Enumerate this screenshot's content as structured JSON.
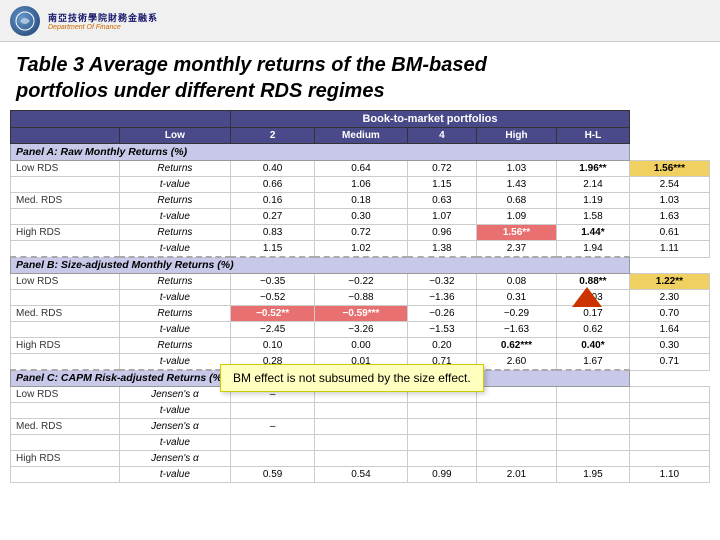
{
  "header": {
    "logo_cn": "南亞技術學院財務金融系",
    "logo_en": "Department Of Finance"
  },
  "title": {
    "line1": "Table 3  Average monthly returns of the BM-based",
    "line2": "portfolios under different RDS regimes"
  },
  "table": {
    "top_header": "Book-to-market portfolios",
    "col_headers": [
      "",
      "Low",
      "2",
      "Medium",
      "4",
      "High",
      "H-L"
    ],
    "panel_a": {
      "label": "Panel A:  Raw Monthly Returns (%)",
      "rows": [
        {
          "group": "Low RDS",
          "row1_label": "Returns",
          "row1_vals": [
            "0.40",
            "0.64",
            "0.72",
            "1.03",
            "1.96**",
            "1.56***"
          ],
          "row2_label": "t-value",
          "row2_vals": [
            "0.66",
            "1.06",
            "1.15",
            "1.43",
            "2.14",
            "2.54"
          ]
        },
        {
          "group": "Med. RDS",
          "row1_label": "Returns",
          "row1_vals": [
            "0.16",
            "0.18",
            "0.63",
            "0.68",
            "1.19",
            "1.03"
          ],
          "row2_label": "t-value",
          "row2_vals": [
            "0.27",
            "0.30",
            "1.07",
            "1.09",
            "1.58",
            "1.63"
          ]
        },
        {
          "group": "High RDS",
          "row1_label": "Returns",
          "row1_vals": [
            "0.83",
            "0.72",
            "0.96",
            "1.56**",
            "1.44*",
            "0.61"
          ],
          "row2_label": "t-value",
          "row2_vals": [
            "1.15",
            "1.02",
            "1.38",
            "2.37",
            "1.94",
            "1.11"
          ]
        }
      ]
    },
    "panel_b": {
      "label": "Panel B:   Size-adjusted Monthly Returns (%)",
      "rows": [
        {
          "group": "Low RDS",
          "row1_label": "Returns",
          "row1_vals": [
            "-0.35",
            "-0.22",
            "-0.32",
            "0.08",
            "0.88**",
            "1.22**"
          ],
          "row2_label": "t-value",
          "row2_vals": [
            "-0.52",
            "-0.88",
            "-1.36",
            "0.31",
            "2.03",
            "2.30"
          ]
        },
        {
          "group": "Med. RDS",
          "row1_label": "Returns",
          "row1_vals": [
            "-0.52**",
            "-0.59***",
            "-0.26",
            "-0.29",
            "0.17",
            "0.70"
          ],
          "row2_label": "t-value",
          "row2_vals": [
            "-2.45",
            "-3.26",
            "-1.53",
            "-1.63",
            "0.62",
            "1.64"
          ]
        },
        {
          "group": "High RDS",
          "row1_label": "Returns",
          "row1_vals": [
            "0.10",
            "0.00",
            "0.20",
            "0.62***",
            "0.40*",
            "0.30"
          ],
          "row2_label": "t-value",
          "row2_vals": [
            "0.28",
            "0.01",
            "0.71",
            "2.60",
            "1.67",
            "0.71"
          ]
        }
      ]
    },
    "panel_c": {
      "label": "Panel C:   CAPM Risk-adjusted Returns (%)",
      "rows": [
        {
          "group": "Low RDS",
          "row1_label": "Jensen's α",
          "row1_vals": [
            "–",
            "–",
            "",
            "",
            "",
            ""
          ],
          "row2_label": "t-value",
          "row2_vals": [
            "",
            "",
            "",
            "",
            "",
            ""
          ]
        },
        {
          "group": "Med. RDS",
          "row1_label": "Jensen's α",
          "row1_vals": [
            "–",
            "",
            "",
            "",
            "",
            ""
          ],
          "row2_label": "t-value",
          "row2_vals": [
            "",
            "",
            "",
            "",
            "",
            ""
          ]
        },
        {
          "group": "High RDS",
          "row1_label": "Jensen's α",
          "row1_vals": [
            "",
            "",
            "",
            "",
            "",
            ""
          ],
          "row2_label": "t-value",
          "row2_vals": [
            "0.59",
            "0.54",
            "0.99",
            "2.01",
            "1.95",
            "1.10"
          ]
        }
      ]
    }
  },
  "tooltip": {
    "text": "BM effect is not subsumed by the size effect."
  }
}
